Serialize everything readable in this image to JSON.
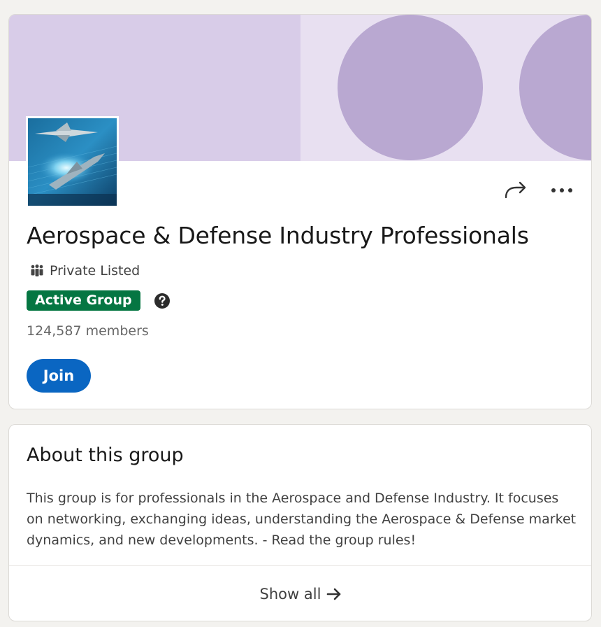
{
  "group": {
    "name": "Aerospace & Defense Industry Professionals",
    "privacy": "Private Listed",
    "badge": "Active Group",
    "members": "124,587 members",
    "join_label": "Join"
  },
  "about": {
    "title": "About this group",
    "description": "This group is for professionals in the Aerospace and Defense Industry. It focuses on networking, exchanging ideas, understanding the Aerospace & Defense market dynamics, and new developments. - Read the group rules!",
    "show_all_label": "Show all"
  },
  "icons": {
    "share": "share-icon",
    "more": "more-icon",
    "privacy": "group-people-icon",
    "help": "help-icon",
    "arrow": "arrow-right-icon"
  },
  "colors": {
    "banner": "#d8cce8",
    "banner_circle": "#b9a8d1",
    "badge": "#057642",
    "join": "#0a66c2",
    "page_bg": "#f3f2ef"
  }
}
